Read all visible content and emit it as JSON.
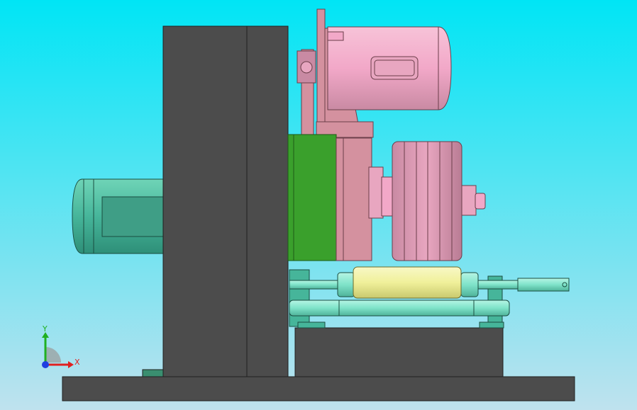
{
  "viewport": {
    "background_top": "#00e5f5",
    "background_bottom": "#bfe2ee"
  },
  "colors": {
    "frame_dark": "#4c4c4c",
    "frame_edge": "#1f1f1f",
    "motor_pink": "#f2a8c8",
    "motor_pink_dark": "#c98aa3",
    "pink_structure": "#d4919f",
    "teal": "#46b59a",
    "teal_dark": "#2e8f78",
    "green_plate": "#3aa02c",
    "yellow_roller": "#f0f09a",
    "shaft_cyan": "#7fe3c9"
  },
  "triad": {
    "x_label": "X",
    "y_label": "Y",
    "x_color": "#e02020",
    "y_color": "#20b020",
    "origin_color": "#2040e0"
  }
}
